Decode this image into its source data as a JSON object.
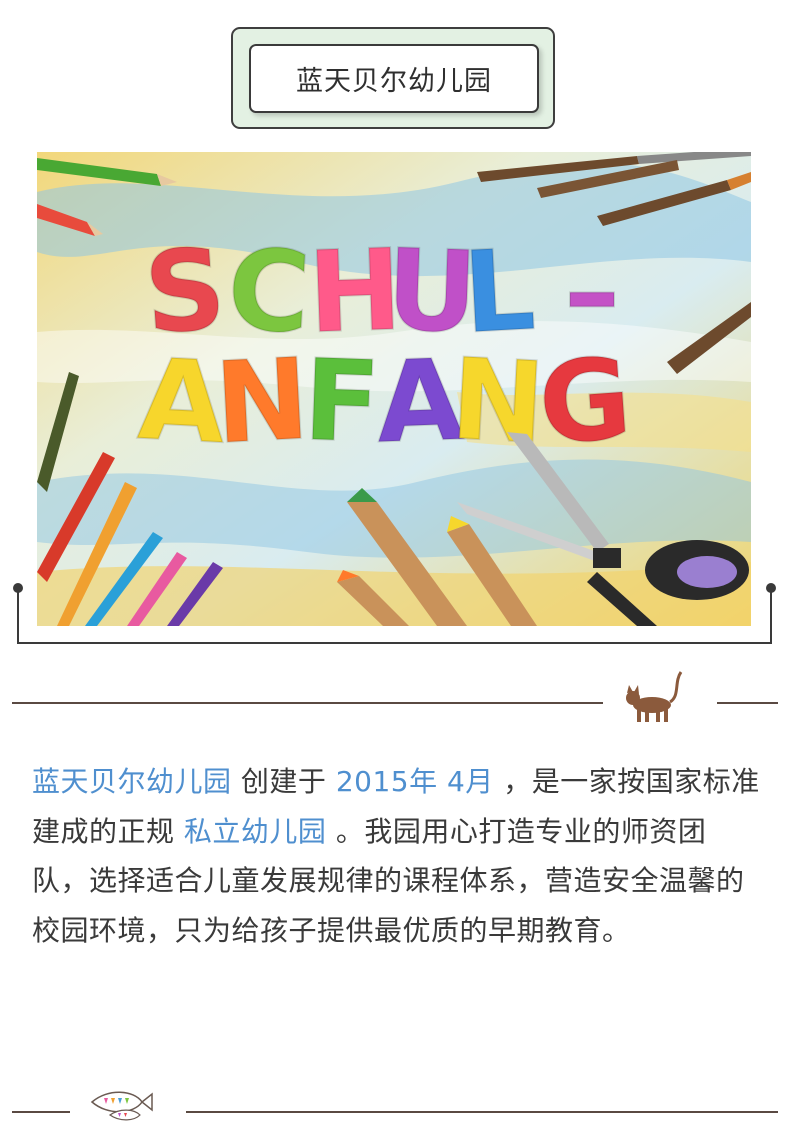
{
  "header": {
    "title": "蓝天贝尔幼儿园"
  },
  "hero": {
    "line1": [
      "S",
      "C",
      "H",
      "U",
      "L",
      "–"
    ],
    "line2": [
      "A",
      "N",
      "F",
      "A",
      "N",
      "G"
    ],
    "letter_colors_1": [
      "#e8484f",
      "#7cc63f",
      "#ff5a8a",
      "#c050c8",
      "#3a8fe0",
      "#c452c6"
    ],
    "letter_colors_2": [
      "#f7d62c",
      "#ff7a2b",
      "#5bbf3b",
      "#7c4ad0",
      "#f6d72c",
      "#e6393f"
    ]
  },
  "intro": {
    "org_name": "蓝天贝尔幼儿园",
    "t1": " 创建于 ",
    "date": "2015年 4月",
    "t2": " ，是一家按国家标准建成的正规 ",
    "org_type": "私立幼儿园",
    "t3": " 。我园用心打造专业的师资团队，选择适合儿童发展规律的课程体系，营造安全温馨的校园环境，只为给孩子提供最优质的早期教育。"
  },
  "colors": {
    "accent": "#4f8fcf",
    "badge_bg": "#e3f1e3",
    "divider": "#5a4a42",
    "cat": "#8b5a3c"
  },
  "icons": {
    "divider_1": "cat-icon",
    "divider_2": "fish-icon"
  }
}
